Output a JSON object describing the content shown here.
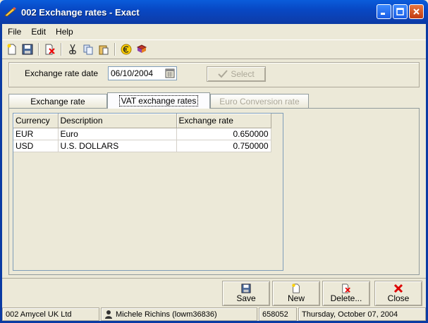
{
  "window": {
    "title": "002 Exchange rates - Exact"
  },
  "menu": [
    {
      "label": "File"
    },
    {
      "label": "Edit"
    },
    {
      "label": "Help"
    }
  ],
  "toolbar": {
    "icons": [
      "new-icon",
      "save-icon",
      "delete-icon",
      "cut-icon",
      "copy-icon",
      "paste-icon",
      "euro-icon",
      "book-icon"
    ]
  },
  "filter": {
    "date_label": "Exchange rate date",
    "date_value": "06/10/2004",
    "select_label": "Select"
  },
  "tabs": [
    {
      "label": "Exchange rate",
      "state": "normal"
    },
    {
      "label": "VAT exchange rates",
      "state": "active"
    },
    {
      "label": "Euro Conversion rate",
      "state": "disabled"
    }
  ],
  "grid": {
    "columns": [
      "Currency",
      "Description",
      "Exchange rate"
    ],
    "rows": [
      {
        "currency": "EUR",
        "description": "Euro",
        "rate": "0.650000"
      },
      {
        "currency": "USD",
        "description": "U.S. DOLLARS",
        "rate": "0.750000"
      }
    ]
  },
  "buttons": {
    "save": "Save",
    "new": "New",
    "delete": "Delete...",
    "close": "Close"
  },
  "status": {
    "company": "002 Amycel UK Ltd",
    "user": "Michele Richins (lowm36836)",
    "code": "658052",
    "date": "Thursday, October 07, 2004"
  },
  "colors": {
    "titlebar": "#0a5cdb",
    "face": "#ece9d8",
    "close_accent": "#c23b12"
  }
}
